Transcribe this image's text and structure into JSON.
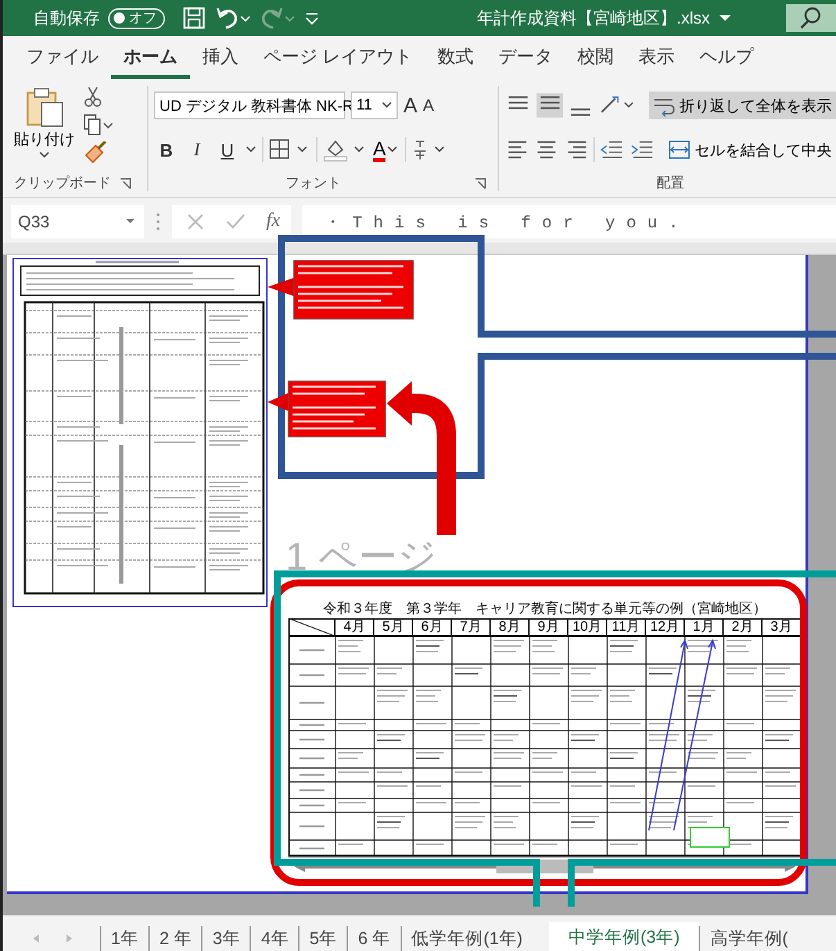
{
  "title_bar": {
    "autosave_label": "自動保存",
    "autosave": {
      "label": "オフ",
      "on": false
    },
    "file_name": "年計作成資料【宮崎地区】.xlsx"
  },
  "ribbon_tabs": [
    {
      "label": "ファイル",
      "selected": false
    },
    {
      "label": "ホーム",
      "selected": true
    },
    {
      "label": "挿入",
      "selected": false
    },
    {
      "label": "ページ レイアウト",
      "selected": false
    },
    {
      "label": "数式",
      "selected": false
    },
    {
      "label": "データ",
      "selected": false
    },
    {
      "label": "校閲",
      "selected": false
    },
    {
      "label": "表示",
      "selected": false
    },
    {
      "label": "ヘルプ",
      "selected": false
    }
  ],
  "ribbon": {
    "paste_label": "貼り付け",
    "font_name": "UD デジタル 教科書体 NK-R",
    "font_size": "11",
    "grow_font": "A",
    "shrink_font": "A",
    "style_buttons": [
      "B",
      "I",
      "U"
    ],
    "font_color": "A",
    "wrap_text": "折り返して全体を表示",
    "merge_center": "セルを結合して中央",
    "groups": [
      "クリップボード",
      "フォント",
      "配置"
    ]
  },
  "formula_bar": {
    "name_box": "Q33",
    "function_label": "fx",
    "formula": "・This is for you."
  },
  "sheet": {
    "page_label": "1 ページ",
    "schedule": {
      "title": "令和３年度　第３学年　キャリア教育に関する単元等の例（宮崎地区）",
      "months": [
        "4月",
        "5月",
        "6月",
        "7月",
        "8月",
        "9月",
        "10月",
        "11月",
        "12月",
        "1月",
        "2月",
        "3月"
      ]
    }
  },
  "sheet_tabs": [
    {
      "label": "1年",
      "selected": false
    },
    {
      "label": "2 年",
      "selected": false
    },
    {
      "label": "3年",
      "selected": false
    },
    {
      "label": "4年",
      "selected": false
    },
    {
      "label": "5年",
      "selected": false
    },
    {
      "label": "6 年",
      "selected": false
    },
    {
      "label": "低学年例(1年)",
      "selected": false
    },
    {
      "label": "中学年例(3年)",
      "selected": true
    },
    {
      "label": "高学年例(",
      "selected": false
    }
  ]
}
